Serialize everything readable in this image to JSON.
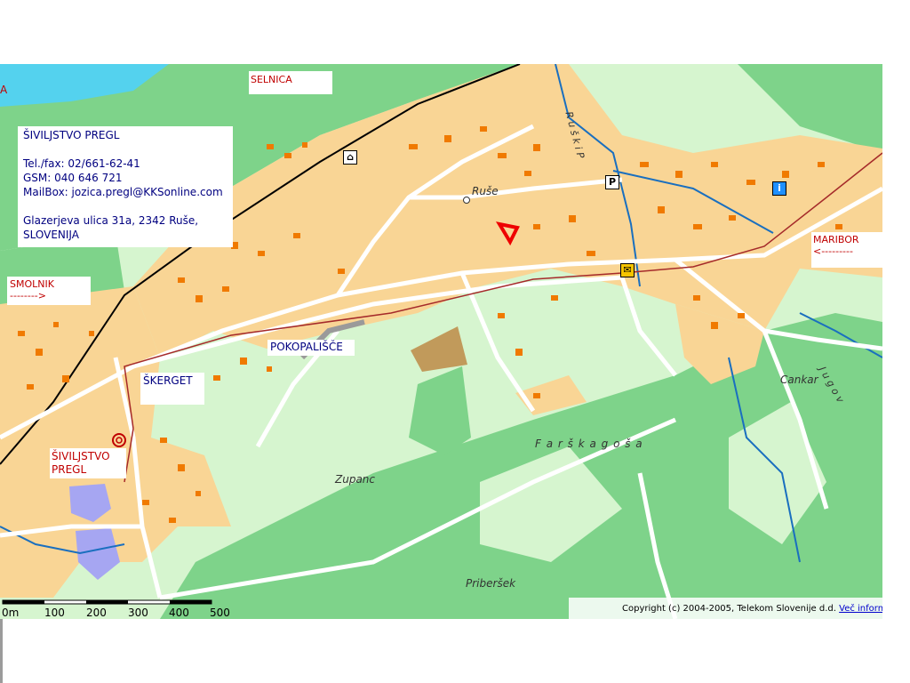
{
  "info_box": {
    "title": "ŠIVILJSTVO PREGL",
    "tel": "Tel./fax: 02/661-62-41",
    "gsm": "GSM: 040 646 721",
    "mail": "MailBox: jozica.pregl@KKSonline.com",
    "address": "Glazerjeva ulica 31a, 2342 Ruše,",
    "country": "SLOVENIJA"
  },
  "labels": {
    "selnica": "SELNICA",
    "smolnik": "SMOLNIK",
    "smolnik_arrow": "-------->",
    "maribor": "MARIBOR",
    "maribor_arrow": "<---------",
    "pokopalisce": "POKOPALIŠČE",
    "skerget": "ŠKERGET",
    "business_line1": "ŠIVILJSTVO",
    "business_line2": "PREGL",
    "edge_a": "A"
  },
  "places": {
    "ruse": "Ruše",
    "farska_gosa": "F a r š k a   g o š a",
    "zupanc": "Zupanc",
    "cankar": "Cankar",
    "jugov": "J u g o v",
    "priber": "Priberšek",
    "ruski_potok": "R u š k i   P"
  },
  "scale": {
    "ticks": [
      "0m",
      "100",
      "200",
      "300",
      "400",
      "500"
    ]
  },
  "copyright": {
    "text": "Copyright (c) 2004-2005, Telekom Slovenije d.d. ",
    "link": "Več informacij..."
  },
  "icons": {
    "train": "train-station-icon",
    "parking": "parking-icon",
    "post": "post-office-icon",
    "info": "info-icon"
  },
  "colors": {
    "forest": "#7ed38a",
    "meadow": "#d6f5cf",
    "urban": "#f9d595",
    "building": "#f07a00",
    "water": "#54d2ee",
    "road": "#ffffff",
    "label_red": "#c00000",
    "label_blue": "#000080"
  }
}
